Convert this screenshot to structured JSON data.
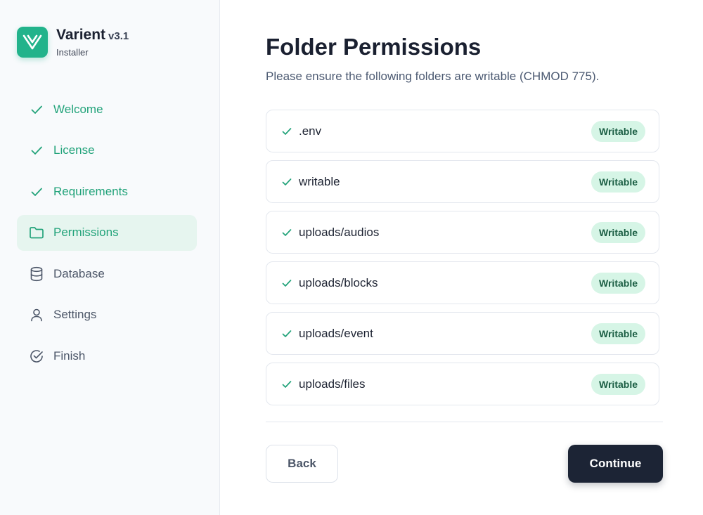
{
  "brand": {
    "name": "Varient",
    "version": "v3.1",
    "subtitle": "Installer",
    "logo_icon": "v-logo-icon",
    "accent": "#22b38b"
  },
  "sidebar": {
    "items": [
      {
        "label": "Welcome",
        "icon": "check-icon",
        "state": "done"
      },
      {
        "label": "License",
        "icon": "check-icon",
        "state": "done"
      },
      {
        "label": "Requirements",
        "icon": "check-icon",
        "state": "done"
      },
      {
        "label": "Permissions",
        "icon": "folder-icon",
        "state": "active"
      },
      {
        "label": "Database",
        "icon": "database-icon",
        "state": "todo"
      },
      {
        "label": "Settings",
        "icon": "user-icon",
        "state": "todo"
      },
      {
        "label": "Finish",
        "icon": "check-circle-icon",
        "state": "todo"
      }
    ]
  },
  "main": {
    "title": "Folder Permissions",
    "subtitle": "Please ensure the following folders are writable (CHMOD 775).",
    "folders": [
      {
        "path": ".env",
        "status": "Writable"
      },
      {
        "path": "writable",
        "status": "Writable"
      },
      {
        "path": "uploads/audios",
        "status": "Writable"
      },
      {
        "path": "uploads/blocks",
        "status": "Writable"
      },
      {
        "path": "uploads/event",
        "status": "Writable"
      },
      {
        "path": "uploads/files",
        "status": "Writable"
      }
    ],
    "back_label": "Back",
    "continue_label": "Continue"
  },
  "colors": {
    "done": "#22a37a",
    "active_bg": "#e6f5ef",
    "badge_bg": "#d6f5e6",
    "badge_text": "#1b5e44",
    "primary_btn": "#1c2435"
  }
}
